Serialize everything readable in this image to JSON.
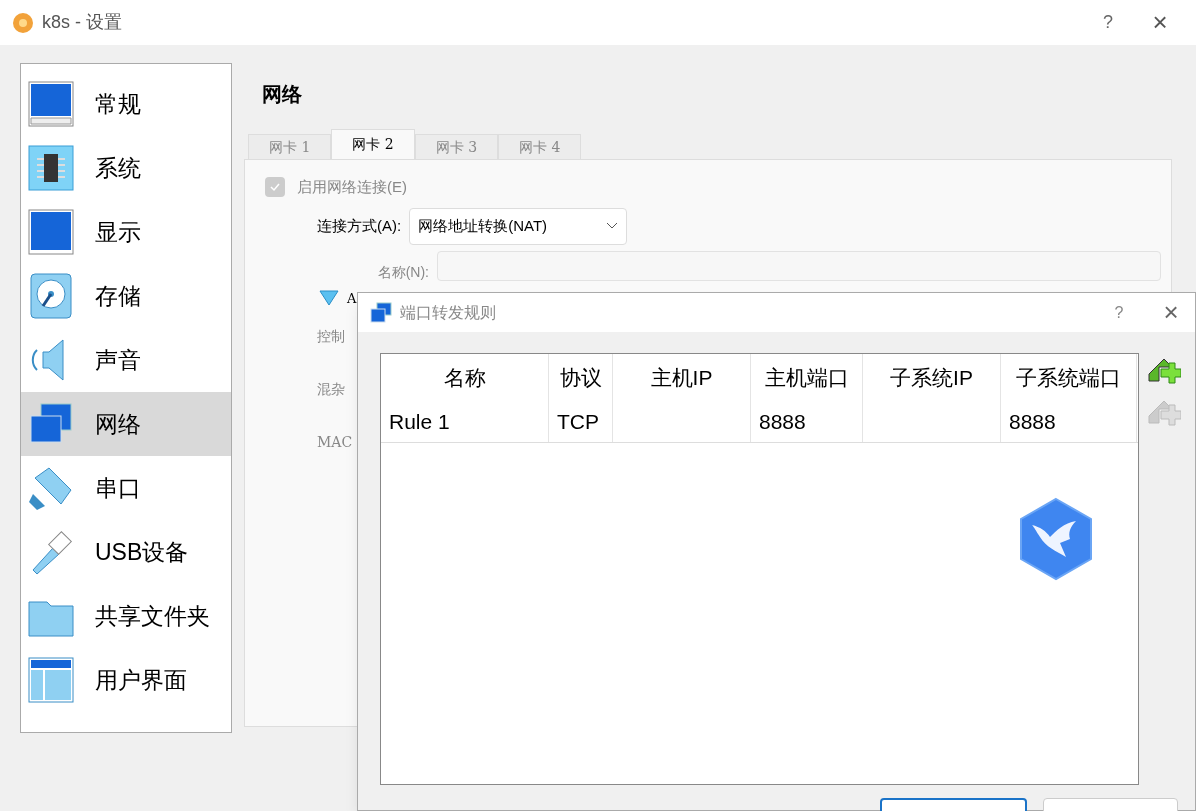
{
  "window": {
    "title": "k8s - 设置",
    "help": "?",
    "close": "×"
  },
  "sidebar": {
    "items": [
      {
        "label": "常规",
        "selected": false
      },
      {
        "label": "系统",
        "selected": false
      },
      {
        "label": "显示",
        "selected": false
      },
      {
        "label": "存储",
        "selected": false
      },
      {
        "label": "声音",
        "selected": false
      },
      {
        "label": "网络",
        "selected": true
      },
      {
        "label": "串口",
        "selected": false
      },
      {
        "label": "USB设备",
        "selected": false
      },
      {
        "label": "共享文件夹",
        "selected": false
      },
      {
        "label": "用户界面",
        "selected": false
      }
    ]
  },
  "page": {
    "heading": "网络",
    "tabs": [
      {
        "label": "网卡 1",
        "selected": false
      },
      {
        "label": "网卡 2",
        "selected": true
      },
      {
        "label": "网卡 3",
        "selected": false
      },
      {
        "label": "网卡 4",
        "selected": false
      }
    ],
    "enable": {
      "label": "启用网络连接(E)",
      "checked": true,
      "disabled": true
    },
    "attached_label": "连接方式(A):",
    "attached_value": "网络地址转换(NAT)",
    "name_label": "名称(N):",
    "advanced": {
      "label": "A",
      "expanded": true
    },
    "cut_labels": [
      "控制",
      "混杂",
      "MAC"
    ]
  },
  "dialog": {
    "title": "端口转发规则",
    "help": "?",
    "close": "×",
    "table": {
      "columns": [
        "名称",
        "协议",
        "主机IP",
        "主机端口",
        "子系统IP",
        "子系统端口"
      ],
      "rows": [
        [
          "Rule 1",
          "TCP",
          null,
          "8888",
          null,
          "8888"
        ]
      ]
    },
    "add_disabled": false,
    "remove_disabled": true
  }
}
